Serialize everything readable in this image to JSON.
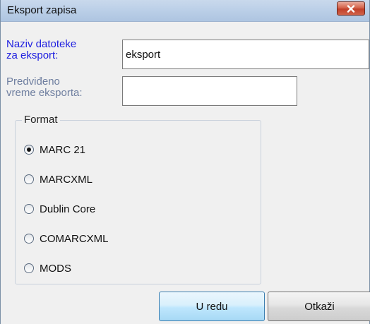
{
  "window": {
    "title": "Eksport zapisa"
  },
  "fields": {
    "filename_label": "Naziv datoteke\nza eksport:",
    "filename_value": "eksport",
    "time_label": "Predviđeno\nvreme eksporta:",
    "time_value": ""
  },
  "format": {
    "legend": "Format",
    "selected": "MARC 21",
    "options": [
      "MARC 21",
      "MARCXML",
      "Dublin Core",
      "COMARCXML",
      "MODS"
    ]
  },
  "buttons": {
    "ok_label": "U redu",
    "cancel_label": "Otkaži"
  },
  "icons": {
    "close": "close-icon"
  },
  "colors": {
    "label_active": "#2020e0",
    "label_inactive": "#6f7fa0",
    "close_button": "#c1402a"
  }
}
